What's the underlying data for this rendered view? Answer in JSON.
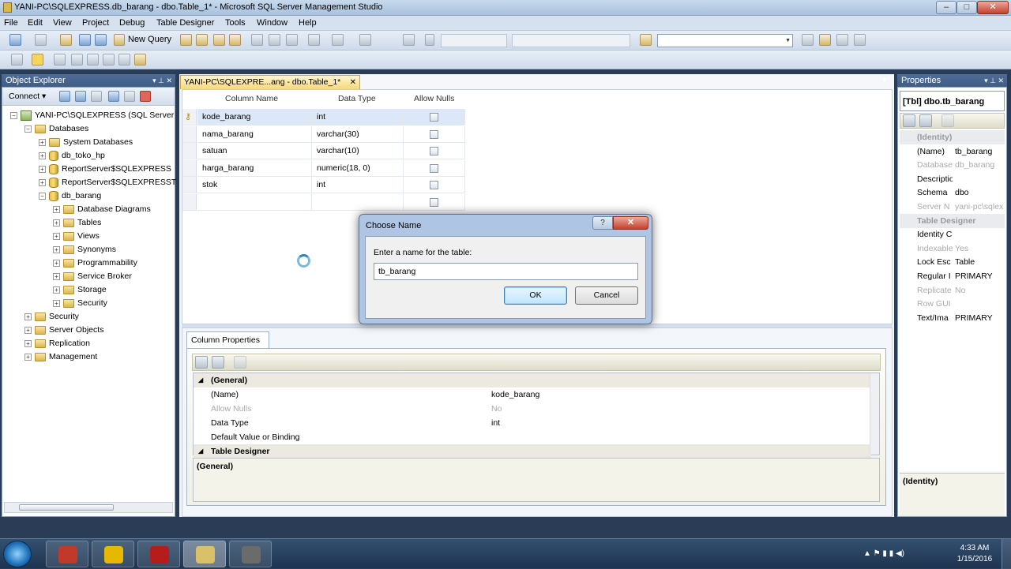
{
  "window": {
    "title": "YANI-PC\\SQLEXPRESS.db_barang - dbo.Table_1* - Microsoft SQL Server Management Studio",
    "min": "–",
    "max": "□",
    "close": "✕"
  },
  "menu": [
    "File",
    "Edit",
    "View",
    "Project",
    "Debug",
    "Table Designer",
    "Tools",
    "Window",
    "Help"
  ],
  "toolbar": {
    "new_query": "New Query"
  },
  "object_explorer": {
    "title": "Object Explorer",
    "pin": "▾ ⊥ ✕",
    "connect": "Connect ▾",
    "tree": [
      {
        "label": "YANI-PC\\SQLEXPRESS (SQL Server",
        "exp": "−",
        "kind": "server"
      },
      {
        "label": "Databases",
        "exp": "−",
        "kind": "folder"
      },
      {
        "label": "System Databases",
        "exp": "+",
        "kind": "folder"
      },
      {
        "label": "db_toko_hp",
        "exp": "+",
        "kind": "db"
      },
      {
        "label": "ReportServer$SQLEXPRESS",
        "exp": "+",
        "kind": "db"
      },
      {
        "label": "ReportServer$SQLEXPRESST",
        "exp": "+",
        "kind": "db"
      },
      {
        "label": "db_barang",
        "exp": "−",
        "kind": "db"
      },
      {
        "label": "Database Diagrams",
        "exp": "+",
        "kind": "folder"
      },
      {
        "label": "Tables",
        "exp": "+",
        "kind": "folder"
      },
      {
        "label": "Views",
        "exp": "+",
        "kind": "folder"
      },
      {
        "label": "Synonyms",
        "exp": "+",
        "kind": "folder"
      },
      {
        "label": "Programmability",
        "exp": "+",
        "kind": "folder"
      },
      {
        "label": "Service Broker",
        "exp": "+",
        "kind": "folder"
      },
      {
        "label": "Storage",
        "exp": "+",
        "kind": "folder"
      },
      {
        "label": "Security",
        "exp": "+",
        "kind": "folder"
      },
      {
        "label": "Security",
        "exp": "+",
        "kind": "folder"
      },
      {
        "label": "Server Objects",
        "exp": "+",
        "kind": "folder"
      },
      {
        "label": "Replication",
        "exp": "+",
        "kind": "folder"
      },
      {
        "label": "Management",
        "exp": "+",
        "kind": "folder"
      }
    ]
  },
  "document_tab": {
    "label": "YANI-PC\\SQLEXPRE...ang - dbo.Table_1*",
    "close": "✕"
  },
  "designer": {
    "headers": {
      "column_name": "Column Name",
      "data_type": "Data Type",
      "allow_nulls": "Allow Nulls"
    },
    "rows": [
      {
        "name": "kode_barang",
        "type": "int",
        "key": "⚷"
      },
      {
        "name": "nama_barang",
        "type": "varchar(30)",
        "key": ""
      },
      {
        "name": "satuan",
        "type": "varchar(10)",
        "key": ""
      },
      {
        "name": "harga_barang",
        "type": "numeric(18, 0)",
        "key": ""
      },
      {
        "name": "stok",
        "type": "int",
        "key": ""
      },
      {
        "name": "",
        "type": "",
        "key": ""
      }
    ]
  },
  "column_properties": {
    "tab": "Column Properties",
    "rows": [
      {
        "name": "(General)",
        "value": "",
        "cat": true,
        "mark": "◢"
      },
      {
        "name": "(Name)",
        "value": "kode_barang"
      },
      {
        "name": "Allow Nulls",
        "value": "No",
        "dim": true
      },
      {
        "name": "Data Type",
        "value": "int"
      },
      {
        "name": "Default Value or Binding",
        "value": ""
      },
      {
        "name": "Table Designer",
        "value": "",
        "cat": true,
        "mark": "◢"
      }
    ],
    "description": "(General)"
  },
  "properties": {
    "title": "Properties",
    "pin": "▾ ⊥ ✕",
    "object": "[Tbl] dbo.tb_barang",
    "rows": [
      {
        "name": "(Identity)",
        "value": "",
        "cat": true
      },
      {
        "name": "(Name)",
        "value": "tb_barang"
      },
      {
        "name": "Database",
        "value": "db_barang",
        "dim": true
      },
      {
        "name": "Description",
        "value": ""
      },
      {
        "name": "Schema",
        "value": "dbo"
      },
      {
        "name": "Server N",
        "value": "yani-pc\\sqlex",
        "dim": true
      },
      {
        "name": "Table Designer",
        "value": "",
        "cat": true
      },
      {
        "name": "Identity C",
        "value": ""
      },
      {
        "name": "Indexable",
        "value": "Yes",
        "dim": true
      },
      {
        "name": "Lock Esc",
        "value": "Table"
      },
      {
        "name": "Regular I",
        "value": "PRIMARY"
      },
      {
        "name": "Replicate",
        "value": "No",
        "dim": true
      },
      {
        "name": "Row GUI",
        "value": "",
        "dim": true
      },
      {
        "name": "Text/Ima",
        "value": "PRIMARY"
      }
    ],
    "description": "(Identity)"
  },
  "dialog": {
    "title": "Choose Name",
    "help": "?",
    "close": "✕",
    "label": "Enter a name for the table:",
    "value": "tb_barang",
    "ok": "OK",
    "cancel": "Cancel"
  },
  "taskbar": {
    "time": "4:33 AM",
    "date": "1/15/2016",
    "apps": [
      {
        "name": "toolbox-app-icon",
        "color": "#c0392b"
      },
      {
        "name": "chrome-app-icon",
        "color": "#e6b800"
      },
      {
        "name": "pdf-app-icon",
        "color": "#b71c1c"
      },
      {
        "name": "ssms-app-icon",
        "color": "#d8c169"
      },
      {
        "name": "tool-app-icon",
        "color": "#6b6b6b"
      }
    ],
    "tray": "▲  ⚑  ▮  ▮  ◀)"
  },
  "colors": {
    "accent": "#4e6d96",
    "tab": "#f7d77a",
    "selected_cell": "#dce8f7"
  }
}
